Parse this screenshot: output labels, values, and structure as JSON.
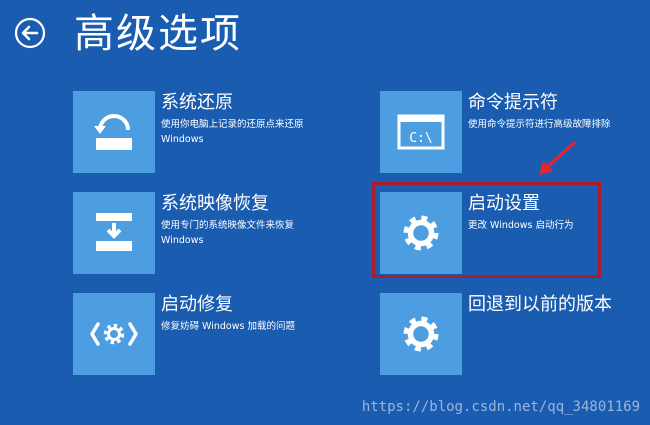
{
  "page": {
    "title": "高级选项"
  },
  "colors": {
    "background": "#1a5cb0",
    "tile": "#4d9ee0",
    "highlight": "#b01b2a",
    "arrow": "#e8232e"
  },
  "options": [
    {
      "title": "系统还原",
      "description": "使用你电脑上记录的还原点来还原\nWindows",
      "icon": "system-restore-icon"
    },
    {
      "title": "系统映像恢复",
      "description": "使用专门的系统映像文件来恢复\nWindows",
      "icon": "system-image-recovery-icon"
    },
    {
      "title": "启动修复",
      "description": "修复妨碍 Windows 加载的问题",
      "icon": "startup-repair-icon"
    },
    {
      "title": "命令提示符",
      "description": "使用命令提示符进行高级故障排除",
      "icon": "command-prompt-icon",
      "icon_text": "C:\\"
    },
    {
      "title": "启动设置",
      "description": "更改 Windows 启动行为",
      "icon": "gear-icon"
    },
    {
      "title": "回退到以前的版本",
      "description": "",
      "icon": "gear-icon"
    }
  ],
  "watermark": "https://blog.csdn.net/qq_34801169"
}
